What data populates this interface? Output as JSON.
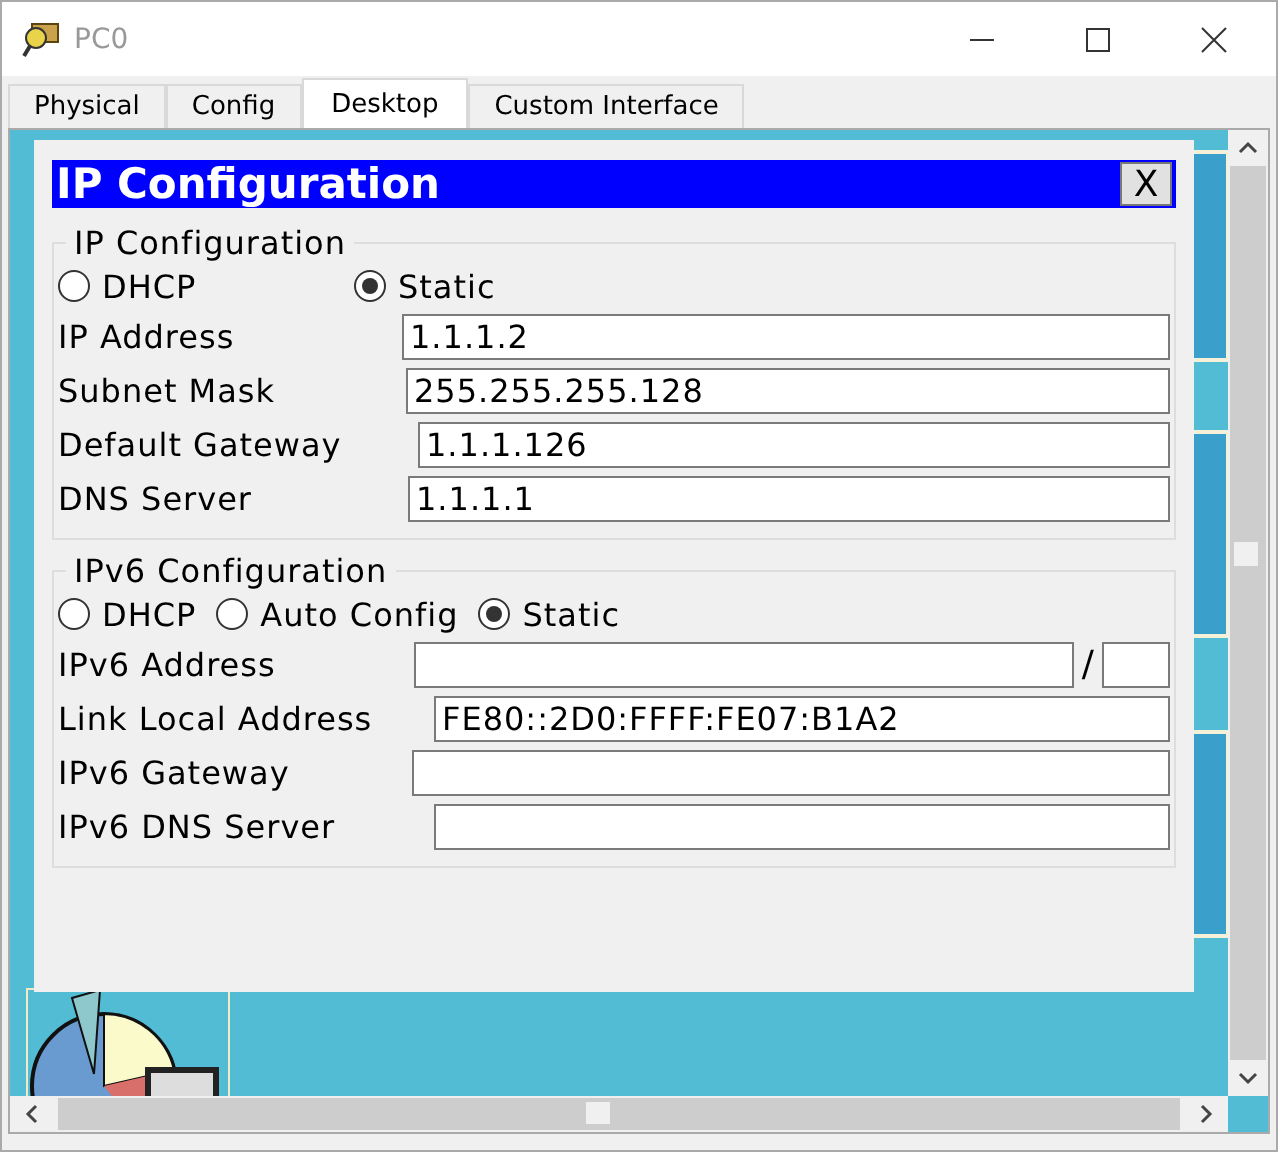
{
  "window": {
    "title": "PC0"
  },
  "tabs": [
    {
      "label": "Physical",
      "selected": false
    },
    {
      "label": "Config",
      "selected": false
    },
    {
      "label": "Desktop",
      "selected": true
    },
    {
      "label": "Custom Interface",
      "selected": false
    }
  ],
  "dialog": {
    "title": "IP Configuration",
    "close": "X",
    "ipv4": {
      "title": "IP Configuration",
      "modes": [
        {
          "label": "DHCP",
          "selected": false
        },
        {
          "label": "Static",
          "selected": true
        }
      ],
      "fields": [
        {
          "label": "IP Address",
          "value": "1.1.1.2"
        },
        {
          "label": "Subnet Mask",
          "value": "255.255.255.128"
        },
        {
          "label": "Default Gateway",
          "value": "1.1.1.126"
        },
        {
          "label": "DNS Server",
          "value": "1.1.1.1"
        }
      ]
    },
    "ipv6": {
      "title": "IPv6 Configuration",
      "modes": [
        {
          "label": "DHCP",
          "selected": false
        },
        {
          "label": "Auto Config",
          "selected": false
        },
        {
          "label": "Static",
          "selected": true
        }
      ],
      "fields": [
        {
          "label": "IPv6 Address",
          "kind": "prefix",
          "separator": "/"
        },
        {
          "label": "Link Local Address",
          "value": "FE80::2D0:FFFF:FE07:B1A2"
        },
        {
          "label": "IPv6 Gateway"
        },
        {
          "label": "IPv6 DNS Server"
        }
      ]
    }
  }
}
